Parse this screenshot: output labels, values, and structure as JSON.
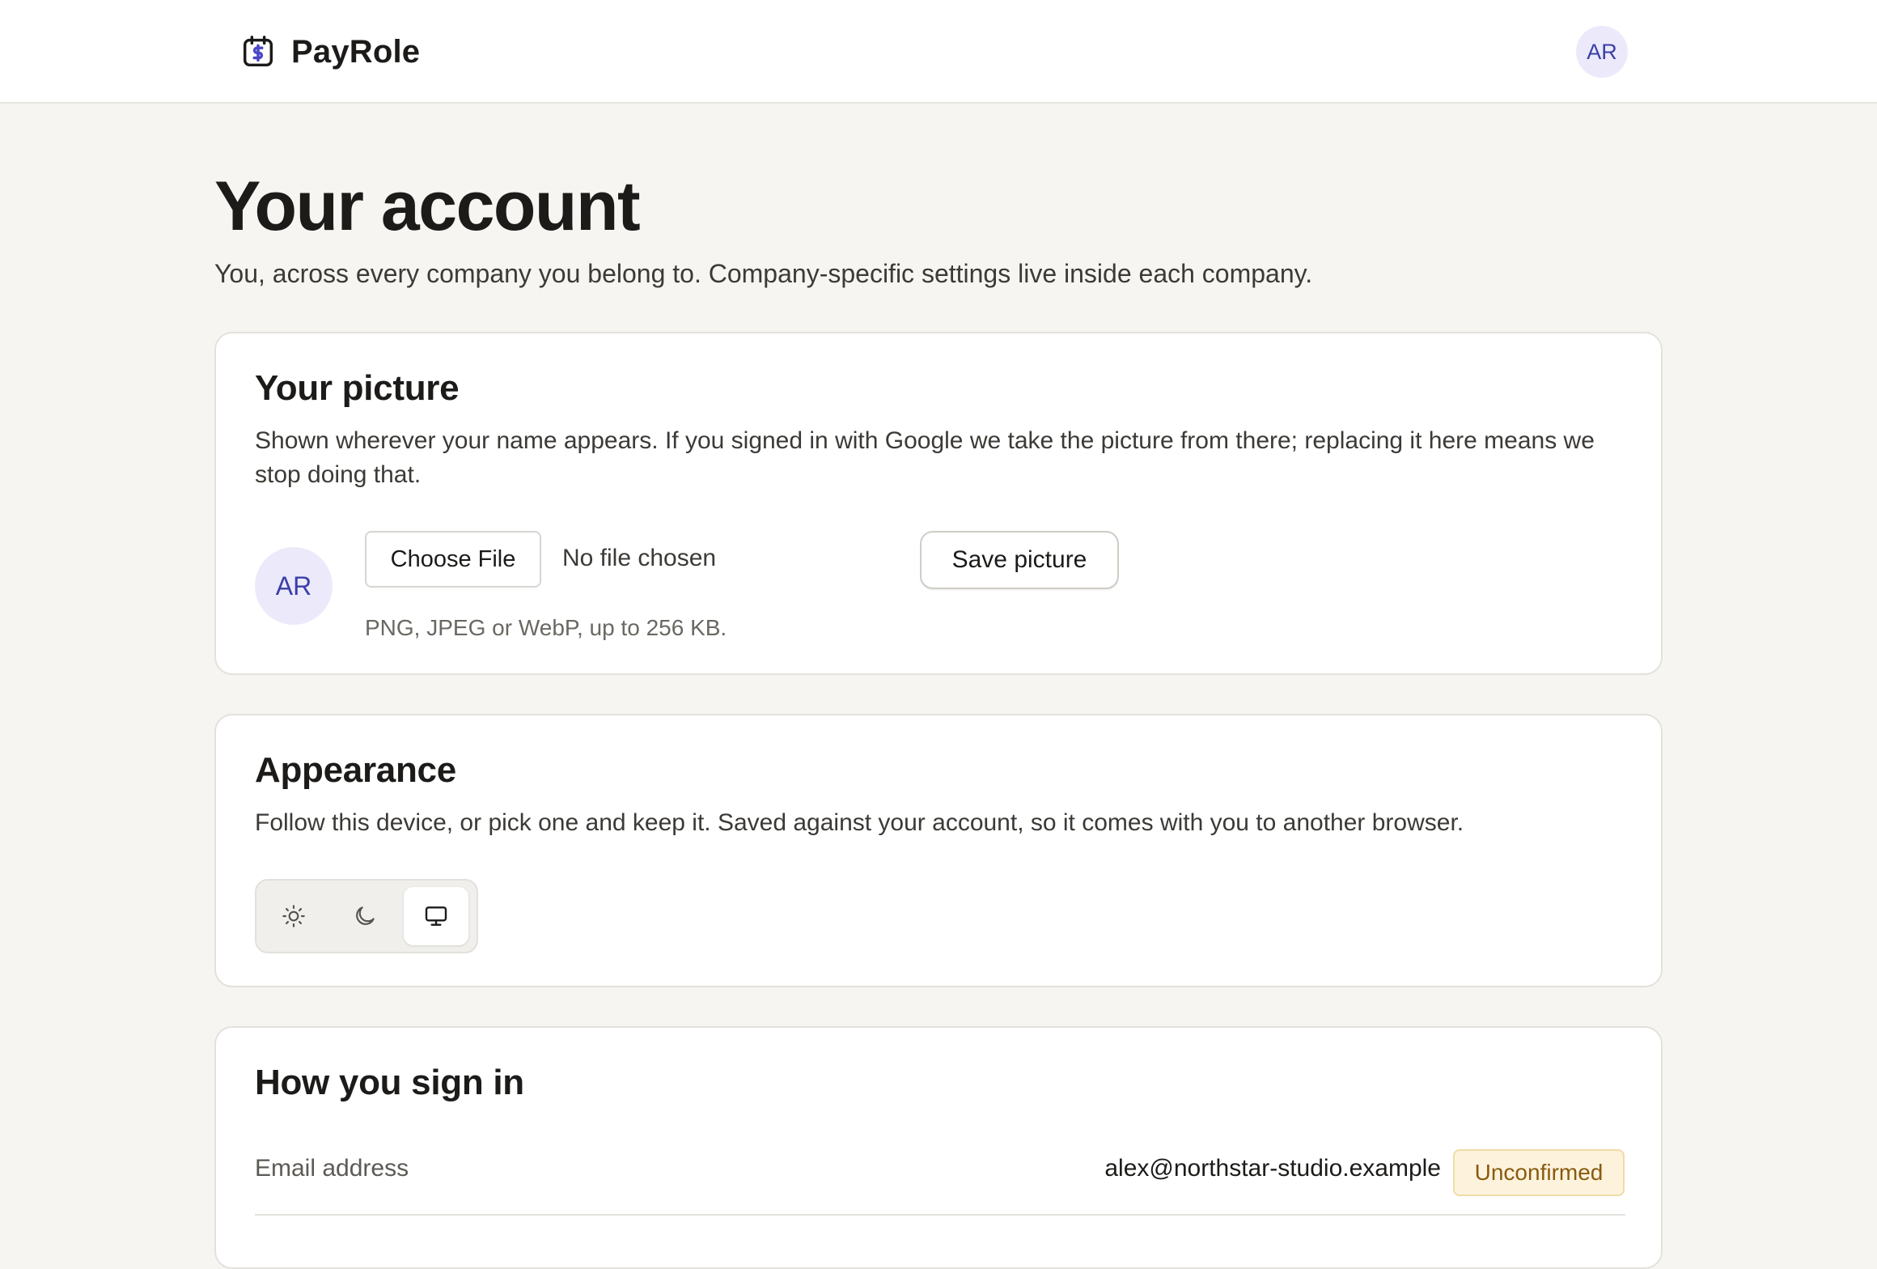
{
  "app": {
    "brand_name": "PayRole",
    "brand_icon": "calendar-dollar-icon",
    "user_initials": "AR"
  },
  "page": {
    "title": "Your account",
    "subtitle": "You, across every company you belong to. Company-specific settings live inside each company."
  },
  "picture_card": {
    "title": "Your picture",
    "description": "Shown wherever your name appears. If you signed in with Google we take the picture from there; replacing it here means we stop doing that.",
    "avatar_initials": "AR",
    "choose_file_label": "Choose File",
    "file_status": "No file chosen",
    "save_label": "Save picture",
    "hint": "PNG, JPEG or WebP, up to 256 KB."
  },
  "appearance_card": {
    "title": "Appearance",
    "description": "Follow this device, or pick one and keep it. Saved against your account, so it comes with you to another browser.",
    "options": [
      {
        "icon": "sun-icon",
        "value": "light"
      },
      {
        "icon": "moon-icon",
        "value": "dark"
      },
      {
        "icon": "monitor-icon",
        "value": "system"
      }
    ],
    "selected": "system"
  },
  "signin_card": {
    "title": "How you sign in",
    "email_label": "Email address",
    "email_value": "alex@northstar-studio.example",
    "email_status": "Unconfirmed"
  },
  "colors": {
    "accent_avatar_bg": "#eceafa",
    "accent_avatar_text": "#3a3fa8",
    "badge_bg": "#fdf3dd",
    "badge_text": "#8a5a0e"
  }
}
